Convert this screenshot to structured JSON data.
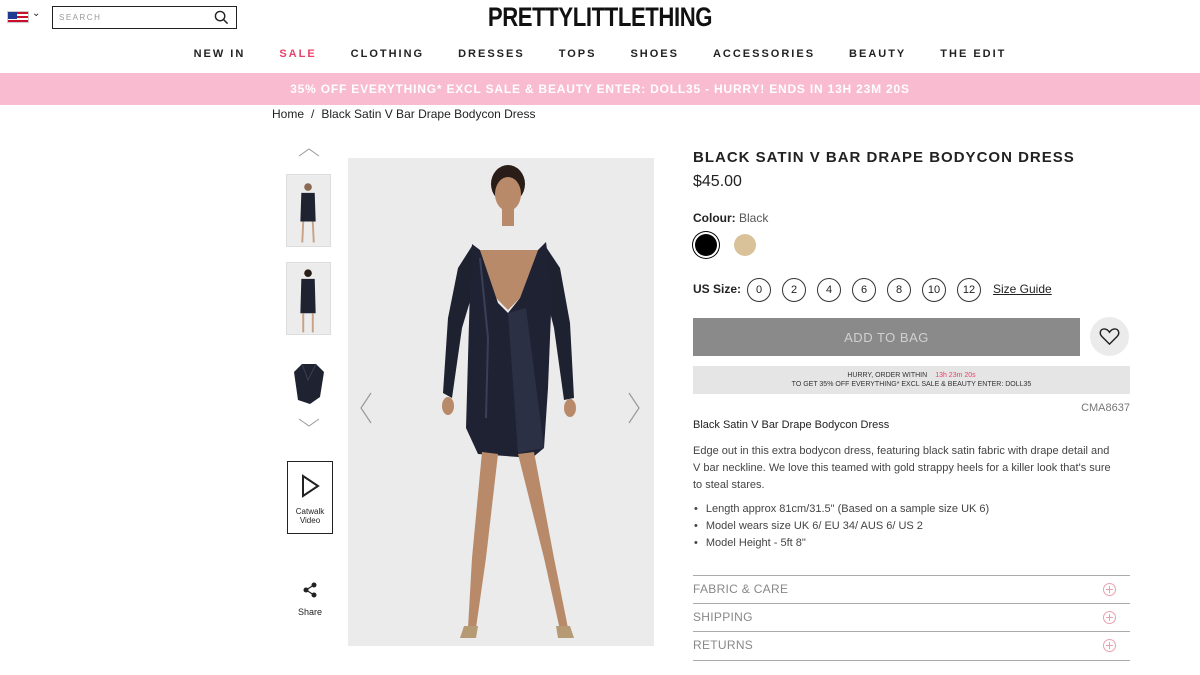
{
  "header": {
    "logo": "PRETTYLITTLETHING",
    "search_placeholder": "SEARCH",
    "nav": [
      "NEW IN",
      "SALE",
      "CLOTHING",
      "DRESSES",
      "TOPS",
      "SHOES",
      "ACCESSORIES",
      "BEAUTY",
      "THE EDIT"
    ]
  },
  "promo": "35% OFF EVERYTHING* EXCL SALE & BEAUTY ENTER: DOLL35 - HURRY! ENDS IN 13H 23M 20S",
  "breadcrumb": {
    "home": "Home",
    "sep": "/",
    "current": "Black Satin V Bar Drape Bodycon Dress"
  },
  "gallery": {
    "catwalk_line1": "Catwalk",
    "catwalk_line2": "Video",
    "share": "Share"
  },
  "product": {
    "title": "BLACK SATIN V BAR DRAPE BODYCON DRESS",
    "price": "$45.00",
    "colour_label": "Colour:",
    "colour_value": "Black",
    "size_label": "US Size:",
    "sizes": [
      "0",
      "2",
      "4",
      "6",
      "8",
      "10",
      "12"
    ],
    "size_guide": "Size Guide",
    "add_to_bag": "ADD TO BAG",
    "hurry_line1": "HURRY, ORDER WITHIN",
    "hurry_time": "13h 23m 20s",
    "hurry_line2": "TO GET 35% OFF EVERYTHING* EXCL SALE & BEAUTY ENTER: DOLL35",
    "code": "CMA8637",
    "desc_title": "Black Satin V Bar Drape Bodycon Dress",
    "description": "Edge out in this extra bodycon dress, featuring black satin fabric with drape detail and V bar neckline. We love this teamed with gold strappy heels for a killer look that's sure to steal stares.",
    "bullets": [
      "Length approx 81cm/31.5\" (Based on a sample size UK 6)",
      "Model wears size UK 6/ EU 34/ AUS 6/ US 2",
      "Model Height - 5ft 8\""
    ],
    "accordions": [
      "FABRIC & CARE",
      "SHIPPING",
      "RETURNS"
    ]
  },
  "colors": {
    "sale": "#e8416a",
    "promo_bg": "#f8bbd0",
    "swatch_black": "#000000",
    "swatch_tan": "#d9c29a"
  },
  "icons": [
    "us-flag-icon",
    "search-icon",
    "chevron-up-icon",
    "chevron-down-icon",
    "play-icon",
    "share-icon",
    "chevron-left-icon",
    "chevron-right-icon",
    "heart-icon",
    "plus-circle-icon"
  ]
}
